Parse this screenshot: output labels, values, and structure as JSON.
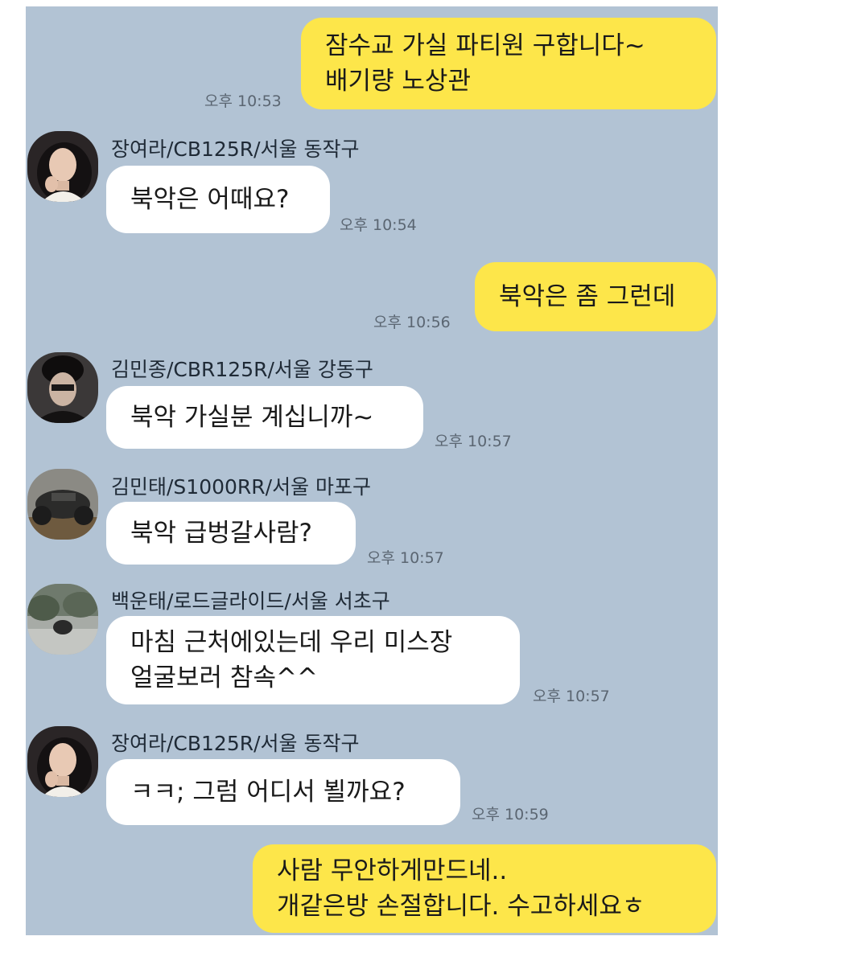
{
  "colors": {
    "chat_bg": "#b2c3d4",
    "my_bubble": "#fde64a",
    "other_bubble": "#ffffff",
    "time_text": "#5b6672"
  },
  "messages": [
    {
      "from": "me",
      "lines": [
        "잠수교 가실 파티원 구합니다~",
        "배기량 노상관"
      ],
      "time": "오후 10:53"
    },
    {
      "from": "other",
      "sender": "장여라/CB125R/서울 동작구",
      "avatar": "woman-portrait",
      "lines": [
        "북악은 어때요?"
      ],
      "time": "오후 10:54"
    },
    {
      "from": "me",
      "lines": [
        "북악은 좀 그런데"
      ],
      "time": "오후 10:56"
    },
    {
      "from": "other",
      "sender": "김민종/CBR125R/서울 강동구",
      "avatar": "man-portrait",
      "lines": [
        "북악 가실분 계십니까~"
      ],
      "time": "오후 10:57"
    },
    {
      "from": "other",
      "sender": "김민태/S1000RR/서울 마포구",
      "avatar": "motorcycle-photo",
      "lines": [
        "북악 급벙갈사람?"
      ],
      "time": "오후 10:57"
    },
    {
      "from": "other",
      "sender": "백운태/로드글라이드/서울 서초구",
      "avatar": "road-photo",
      "lines": [
        "마침 근처에있는데 우리 미스장",
        "얼굴보러 참속^^"
      ],
      "time": "오후 10:57"
    },
    {
      "from": "other",
      "sender": "장여라/CB125R/서울 동작구",
      "avatar": "woman-portrait",
      "lines": [
        "ㅋㅋ; 그럼 어디서 뵐까요?"
      ],
      "time": "오후 10:59"
    },
    {
      "from": "me",
      "lines": [
        "사람 무안하게만드네..",
        "개같은방 손절합니다. 수고하세요ㅎ"
      ],
      "time": ""
    }
  ]
}
